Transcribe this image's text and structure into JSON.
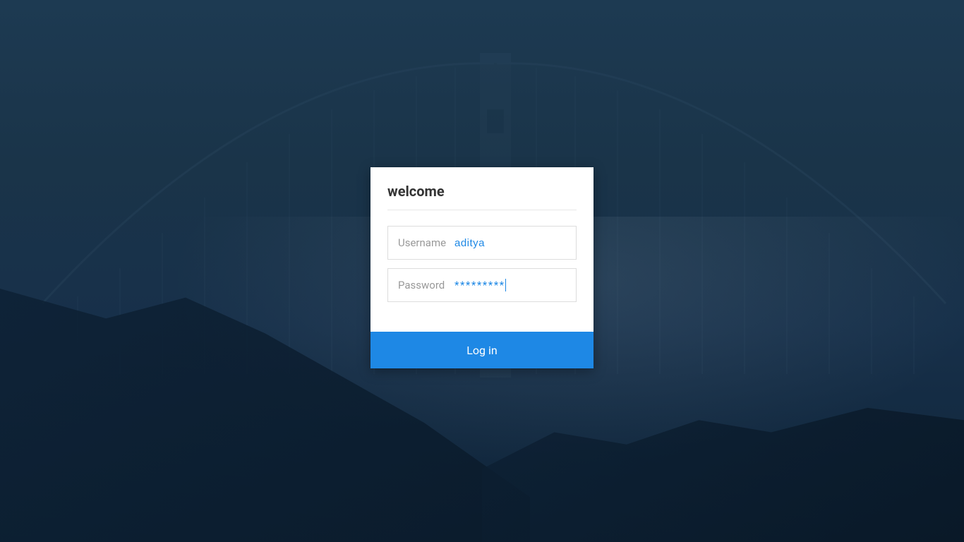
{
  "card": {
    "title": "welcome",
    "username_label": "Username",
    "username_value": "aditya",
    "password_label": "Password",
    "password_value": "*********",
    "login_button_label": "Log in"
  },
  "colors": {
    "accent": "#1e88e5",
    "background": "#1d3a52"
  }
}
